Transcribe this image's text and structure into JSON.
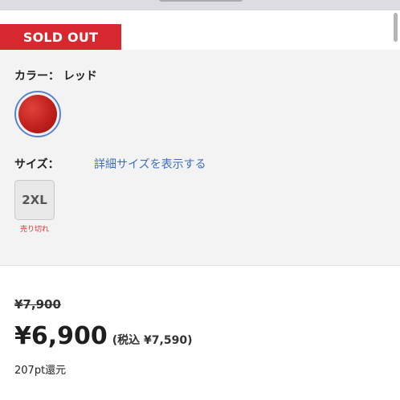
{
  "badge": {
    "sold_out": "SOLD OUT"
  },
  "color": {
    "label": "カラー：",
    "value": "レッド",
    "swatch_color": "#c0201d",
    "swatch_border": "#5b84cf"
  },
  "size": {
    "label": "サイズ：",
    "detail_link": "詳細サイズを表示する",
    "options": [
      {
        "label": "2XL",
        "status": "売り切れ"
      }
    ]
  },
  "price": {
    "original": "¥7,900",
    "current": "¥6,900",
    "tax_included": "(税込 ¥7,590)",
    "points": "207pt還元"
  },
  "colors": {
    "sold_out_bg": "#d7272f",
    "link": "#3f6fbf",
    "sold_out_text": "#dd3333"
  }
}
